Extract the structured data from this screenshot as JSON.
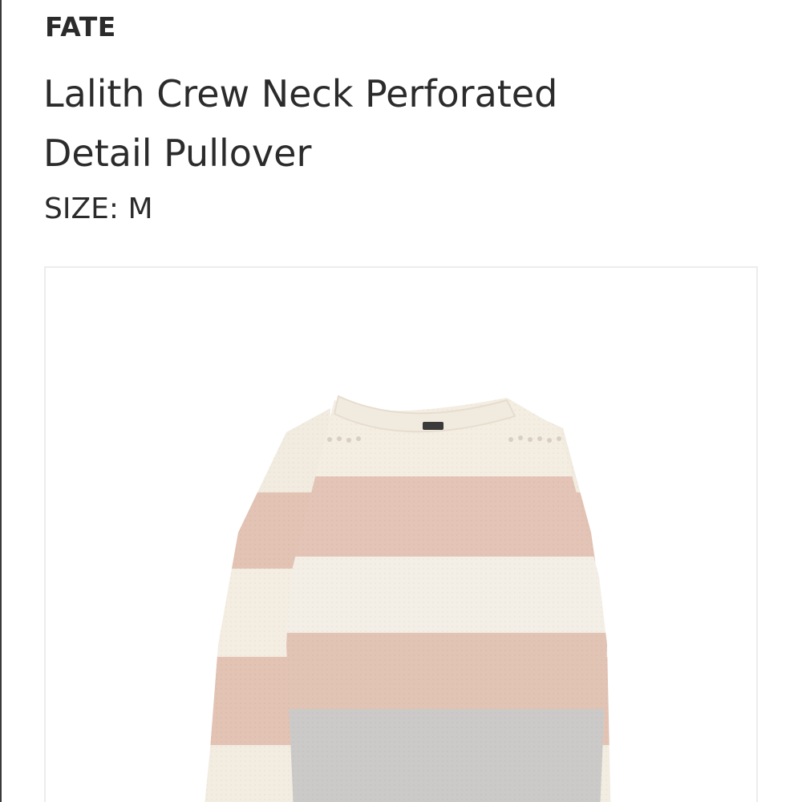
{
  "product": {
    "brand": "FATE",
    "title_line1": "Lalith Crew Neck Perforated",
    "title_line2": "Detail Pullover",
    "size_label": "SIZE: M"
  },
  "image": {
    "subject": "sweater-photo",
    "colors": {
      "cream": "#f3ede2",
      "blush": "#e3c4b6",
      "gray": "#c9c8c6",
      "frame_border": "#ececec"
    }
  }
}
